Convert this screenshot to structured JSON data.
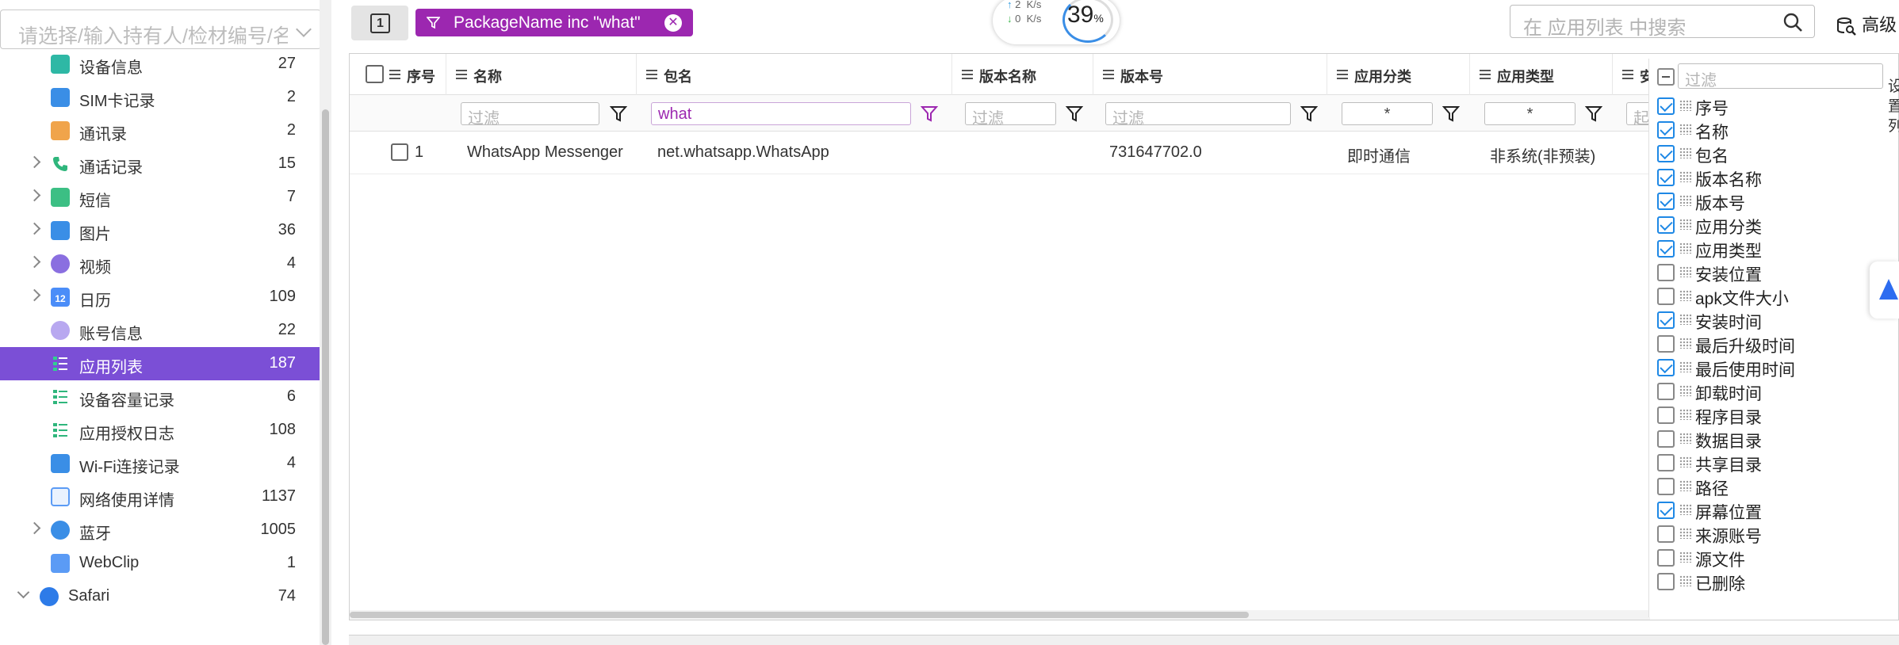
{
  "sidebar": {
    "search_placeholder": "请选择/输入持有人/检材编号/名",
    "items": [
      {
        "label": "设备信息",
        "count": "27"
      },
      {
        "label": "SIM卡记录",
        "count": "2"
      },
      {
        "label": "通讯录",
        "count": "2"
      },
      {
        "label": "通话记录",
        "count": "15"
      },
      {
        "label": "短信",
        "count": "7"
      },
      {
        "label": "图片",
        "count": "36"
      },
      {
        "label": "视频",
        "count": "4"
      },
      {
        "label": "日历",
        "count": "109"
      },
      {
        "label": "账号信息",
        "count": "22"
      },
      {
        "label": "应用列表",
        "count": "187"
      },
      {
        "label": "设备容量记录",
        "count": "6"
      },
      {
        "label": "应用授权日志",
        "count": "108"
      },
      {
        "label": "Wi-Fi连接记录",
        "count": "4"
      },
      {
        "label": "网络使用详情",
        "count": "1137"
      },
      {
        "label": "蓝牙",
        "count": "1005"
      },
      {
        "label": "WebClip",
        "count": "1"
      },
      {
        "label": "Safari",
        "count": "74"
      }
    ],
    "calendar_icon_text": "12"
  },
  "toolbar": {
    "page_button_label": "1",
    "filter_chip": "PackageName inc \"what\"",
    "filter_chip_close": "✕",
    "speed_up": "2",
    "speed_down": "0",
    "speed_unit": "K/s",
    "percent": "39",
    "percent_sign": "%",
    "search_placeholder": "在 应用列表 中搜索",
    "advanced_label": "高级"
  },
  "grid": {
    "columns": [
      "序号",
      "名称",
      "包名",
      "版本名称",
      "版本号",
      "应用分类",
      "应用类型",
      "安"
    ],
    "filter_placeholder": "过滤",
    "package_filter_value": "what",
    "select_value": "*",
    "cut_filter": "起",
    "rows": [
      {
        "index": "1",
        "name": "WhatsApp Messenger",
        "package": "net.whatsapp.WhatsApp",
        "version_name": "",
        "version_code": "731647702.0",
        "category": "即时通信",
        "type": "非系统(非预装)"
      }
    ]
  },
  "chooser": {
    "filter_placeholder": "过滤",
    "items": [
      {
        "label": "序号",
        "checked": true
      },
      {
        "label": "名称",
        "checked": true
      },
      {
        "label": "包名",
        "checked": true
      },
      {
        "label": "版本名称",
        "checked": true
      },
      {
        "label": "版本号",
        "checked": true
      },
      {
        "label": "应用分类",
        "checked": true
      },
      {
        "label": "应用类型",
        "checked": true
      },
      {
        "label": "安装位置",
        "checked": false
      },
      {
        "label": "apk文件大小",
        "checked": false
      },
      {
        "label": "安装时间",
        "checked": true
      },
      {
        "label": "最后升级时间",
        "checked": false
      },
      {
        "label": "最后使用时间",
        "checked": true
      },
      {
        "label": "卸载时间",
        "checked": false
      },
      {
        "label": "程序目录",
        "checked": false
      },
      {
        "label": "数据目录",
        "checked": false
      },
      {
        "label": "共享目录",
        "checked": false
      },
      {
        "label": "路径",
        "checked": false
      },
      {
        "label": "屏幕位置",
        "checked": true
      },
      {
        "label": "来源账号",
        "checked": false
      },
      {
        "label": "源文件",
        "checked": false
      },
      {
        "label": "已删除",
        "checked": false
      }
    ]
  },
  "side_panel": {
    "chars": [
      "设",
      "置",
      "列"
    ]
  },
  "colors": {
    "accent": "#7b4fd6",
    "filter_chip": "#9c27b0",
    "check": "#1e88e5"
  }
}
